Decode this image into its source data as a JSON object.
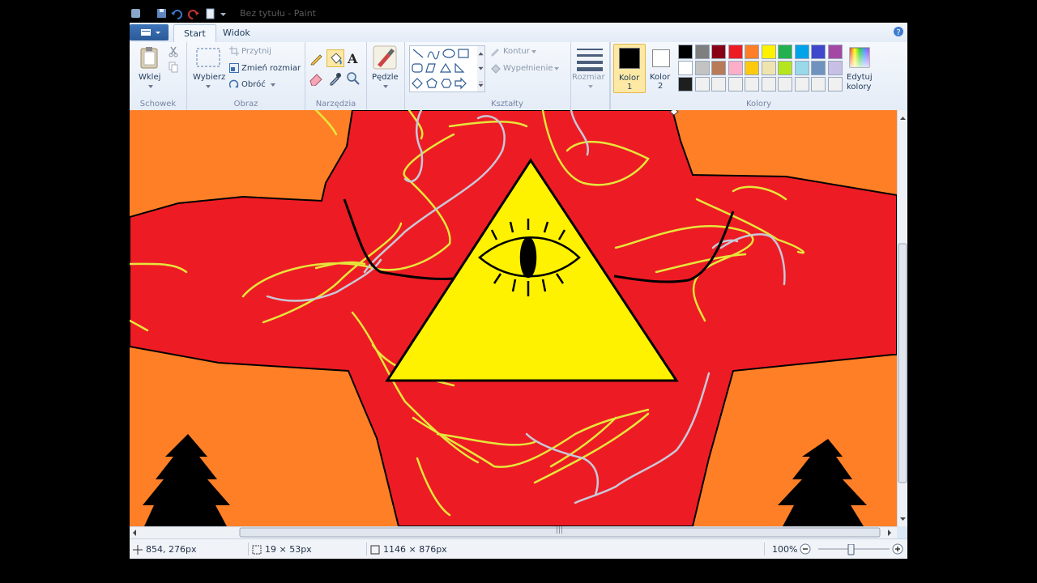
{
  "window": {
    "title": "Bez tytułu - Paint"
  },
  "tabs": [
    {
      "label": "Start"
    },
    {
      "label": "Widok"
    }
  ],
  "ribbon": {
    "clipboard": {
      "label": "Schowek",
      "paste": "Wklej"
    },
    "image": {
      "label": "Obraz",
      "select": "Wybierz",
      "crop": "Przytnij",
      "resize": "Zmień rozmiar",
      "rotate": "Obróć"
    },
    "tools": {
      "label": "Narzędzia"
    },
    "brushes": {
      "label": "Pędzle"
    },
    "shapes": {
      "label": "Kształty",
      "outline": "Kontur",
      "fill": "Wypełnienie"
    },
    "size": {
      "label": "Rozmiar"
    },
    "colors": {
      "label": "Kolory",
      "color1": {
        "line1": "Kolor",
        "line2": "1",
        "value": "#000000"
      },
      "color2": {
        "line1": "Kolor",
        "line2": "2",
        "value": "#ffffff"
      },
      "edit_line1": "Edytuj",
      "edit_line2": "kolory",
      "palette_row1": [
        "#000000",
        "#7f7f7f",
        "#880015",
        "#ed1c24",
        "#ff7f27",
        "#fff200",
        "#22b14c",
        "#00a2e8",
        "#3f48cc",
        "#a349a4"
      ],
      "palette_row2": [
        "#ffffff",
        "#c3c3c3",
        "#b97a57",
        "#ffaec9",
        "#ffc90e",
        "#efe4b0",
        "#b5e61d",
        "#99d9ea",
        "#7092be",
        "#c8bfe7"
      ],
      "palette_row3": [
        "#1e1e1e",
        "#f0f0f0",
        "#f0f0f0",
        "#f0f0f0",
        "#f0f0f0",
        "#f0f0f0",
        "#f0f0f0",
        "#f0f0f0",
        "#f0f0f0",
        "#f0f0f0"
      ]
    }
  },
  "status": {
    "cursor_pos": "854, 276px",
    "selection_size": "19 × 53px",
    "image_size": "1146 × 876px",
    "zoom": "100%"
  },
  "scrollbar_grip": "|||"
}
